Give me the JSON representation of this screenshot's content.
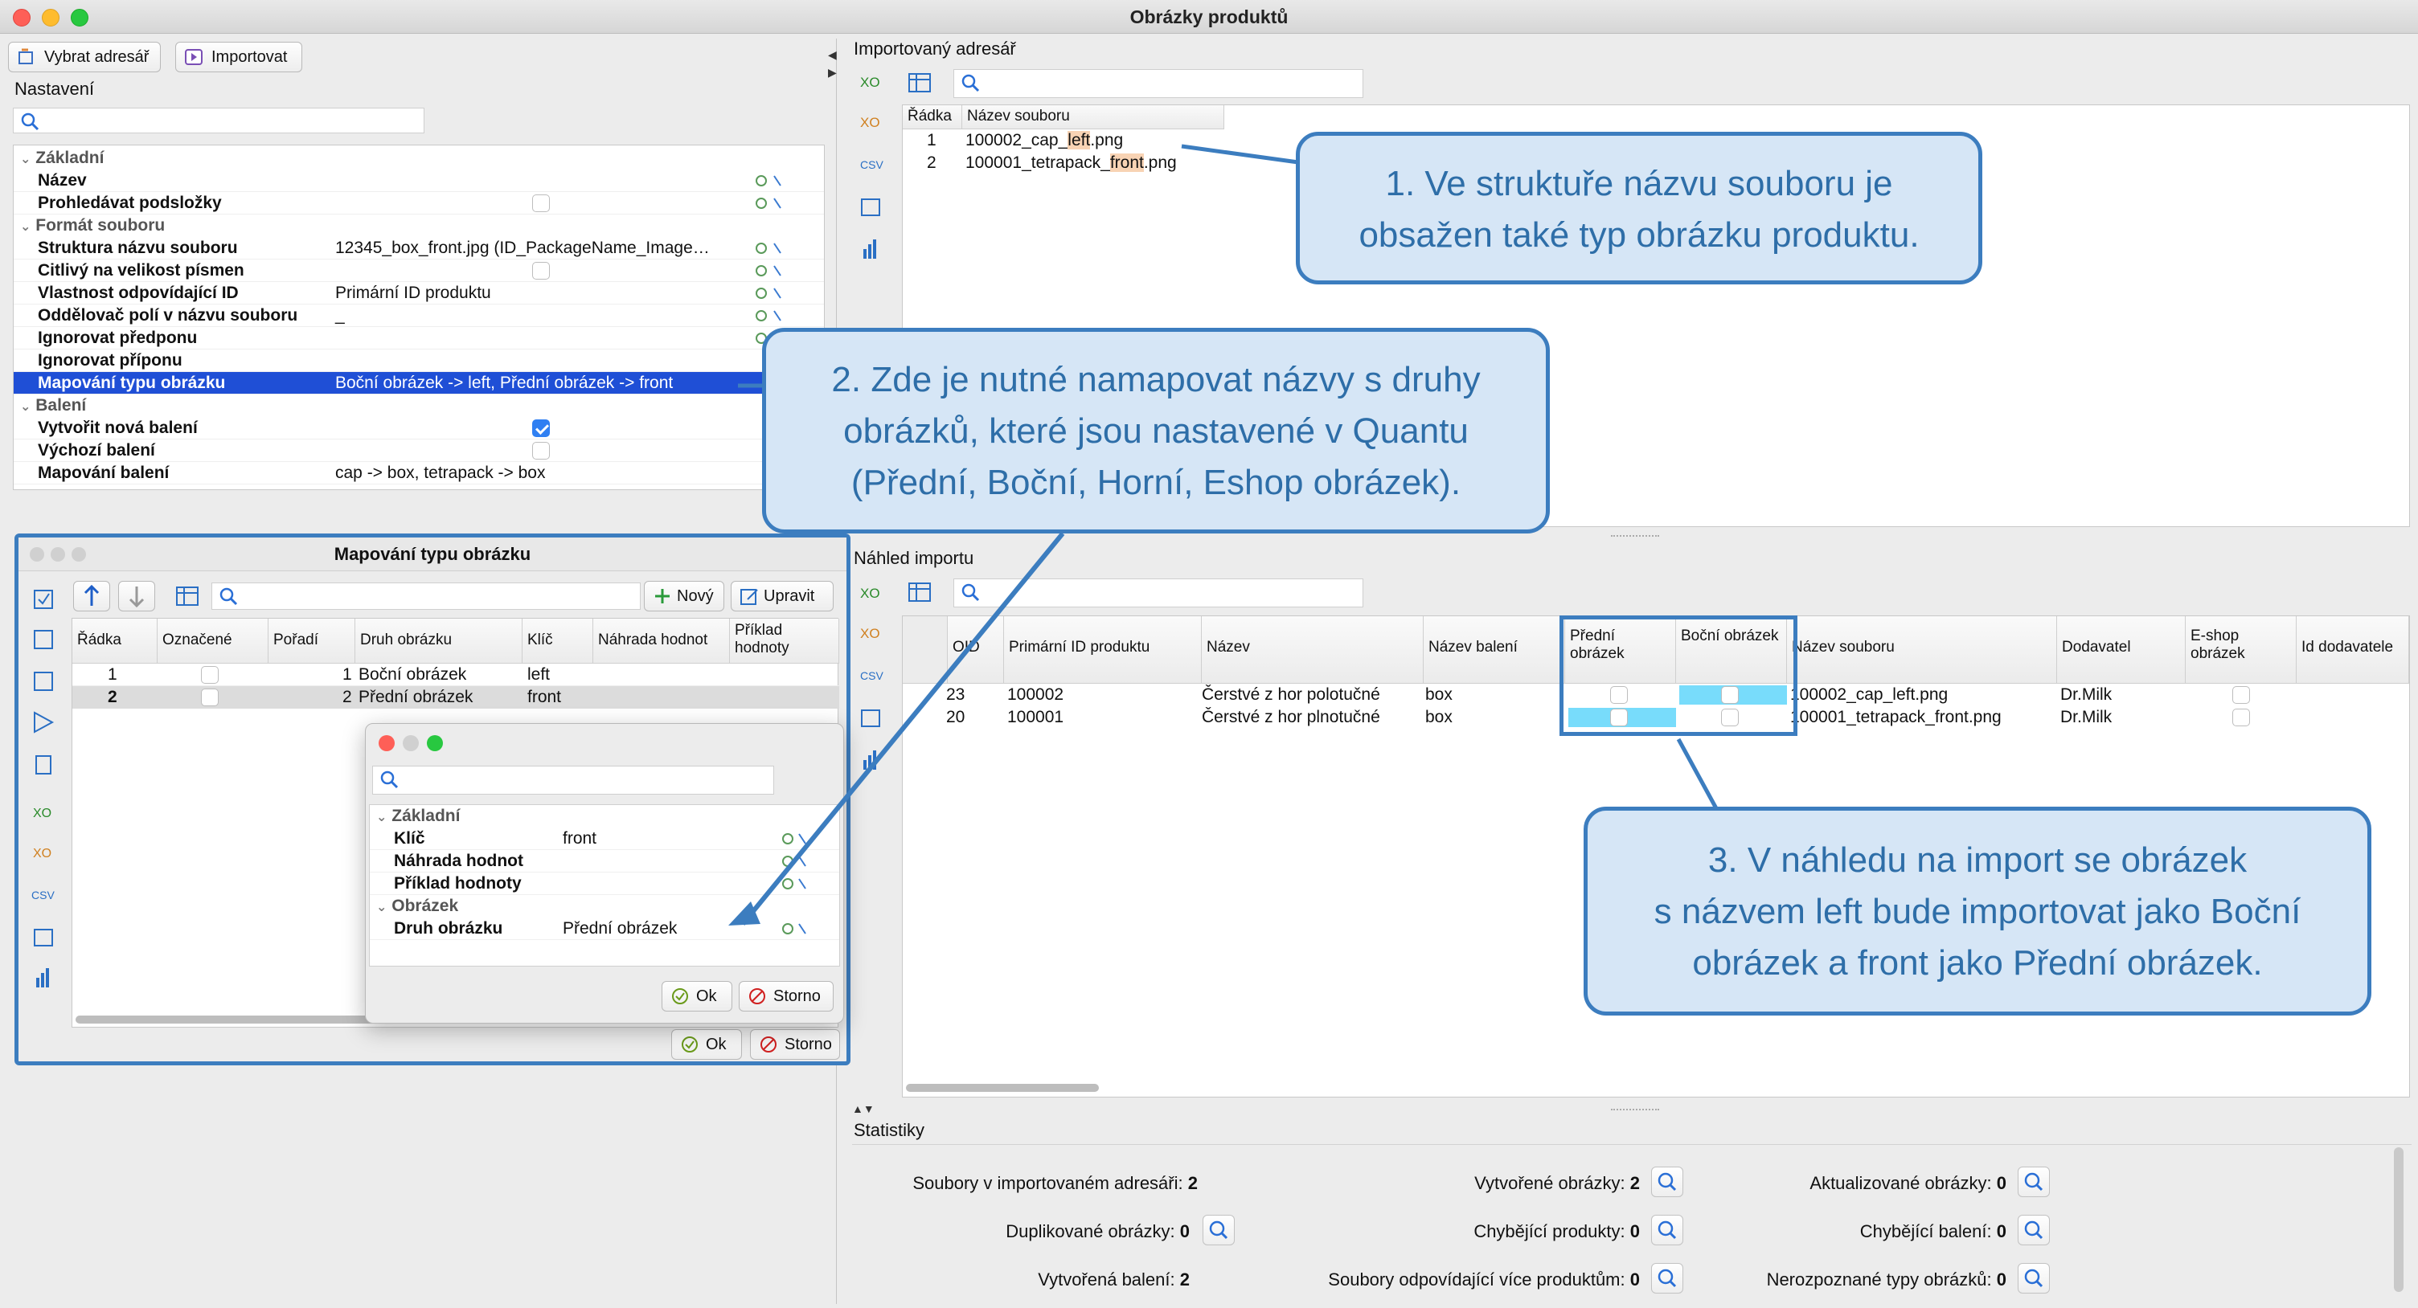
{
  "window": {
    "title": "Obrázky produktů"
  },
  "toolbar": {
    "select_dir": "Vybrat adresář",
    "import": "Importovat"
  },
  "settings": {
    "title": "Nastavení",
    "groups": {
      "basic": "Základní",
      "format": "Formát souboru",
      "packaging": "Balení"
    },
    "rows": [
      {
        "label": "Název",
        "value": ""
      },
      {
        "label": "Prohledávat podsložky",
        "value": ""
      },
      {
        "label": "Struktura názvu souboru",
        "value": "12345_box_front.jpg (ID_PackageName_Image…"
      },
      {
        "label": "Citlivý na velikost písmen",
        "value": ""
      },
      {
        "label": "Vlastnost odpovídající ID",
        "value": "Primární ID produktu"
      },
      {
        "label": "Oddělovač polí v názvu souboru",
        "value": "_"
      },
      {
        "label": "Ignorovat předponu",
        "value": ""
      },
      {
        "label": "Ignorovat příponu",
        "value": ""
      },
      {
        "label": "Mapování typu obrázku",
        "value": "Boční obrázek -> left, Přední obrázek -> front"
      },
      {
        "label": "Vytvořit nová balení",
        "value": ""
      },
      {
        "label": "Výchozí balení",
        "value": ""
      },
      {
        "label": "Mapování balení",
        "value": "cap -> box, tetrapack -> box"
      }
    ]
  },
  "mapping_dialog": {
    "title": "Mapování typu obrázku",
    "new": "Nový",
    "edit": "Upravit",
    "columns": [
      "Řádka",
      "Označené",
      "Pořadí",
      "Druh obrázku",
      "Klíč",
      "Náhrada hodnot",
      "Příklad hodnoty"
    ],
    "rows": [
      {
        "row": "1",
        "order": "1",
        "type": "Boční obrázek",
        "key": "left"
      },
      {
        "row": "2",
        "order": "2",
        "type": "Přední obrázek",
        "key": "front"
      }
    ],
    "ok": "Ok",
    "cancel": "Storno"
  },
  "edit_dialog": {
    "group_basic": "Základní",
    "key_label": "Klíč",
    "key_value": "front",
    "replace_label": "Náhrada hodnot",
    "example_label": "Příklad hodnoty",
    "group_image": "Obrázek",
    "type_label": "Druh obrázku",
    "type_value": "Přední obrázek",
    "ok": "Ok",
    "cancel": "Storno"
  },
  "imported_dir": {
    "title": "Importovaný adresář",
    "columns": [
      "Řádka",
      "Název souboru"
    ],
    "rows": [
      {
        "row": "1",
        "pre": "100002_cap_",
        "hl": "left",
        "post": ".png"
      },
      {
        "row": "2",
        "pre": "100001_tetrapack_",
        "hl": "front",
        "post": ".png"
      }
    ]
  },
  "preview": {
    "title": "Náhled importu",
    "columns": [
      "OID",
      "Primární ID produktu",
      "Název",
      "Název balení",
      "Přední obrázek",
      "Boční obrázek",
      "Název souboru",
      "Dodavatel",
      "E-shop obrázek",
      "Id dodavatele"
    ],
    "rows": [
      {
        "oid": "23",
        "pid": "100002",
        "name": "Čerstvé z hor polotučné",
        "pack": "box",
        "file": "100002_cap_left.png",
        "supplier": "Dr.Milk"
      },
      {
        "oid": "20",
        "pid": "100001",
        "name": "Čerstvé z hor plnotučné",
        "pack": "box",
        "file": "100001_tetrapack_front.png",
        "supplier": "Dr.Milk"
      }
    ]
  },
  "stats": {
    "title": "Statistiky",
    "files_label": "Soubory v importovaném adresáři:",
    "files_value": "2",
    "dup_label": "Duplikované obrázky:",
    "dup_value": "0",
    "pack_label": "Vytvořená balení:",
    "pack_value": "2",
    "created_label": "Vytvořené obrázky:",
    "created_value": "2",
    "missing_label": "Chybějící produkty:",
    "missing_value": "0",
    "multi_label": "Soubory odpovídající více produktům:",
    "multi_value": "0",
    "updated_label": "Aktualizované obrázky:",
    "updated_value": "0",
    "missing_pack_label": "Chybějící balení:",
    "missing_pack_value": "0",
    "unknown_label": "Nerozpoznané typy obrázků:",
    "unknown_value": "0"
  },
  "callouts": {
    "c1_line1": "1. Ve struktuře názvu souboru je",
    "c1_line2": "obsažen také typ obrázku produktu.",
    "c2_line1": "2. Zde je nutné namapovat názvy s druhy",
    "c2_line2": "obrázků, které jsou nastavené v Quantu",
    "c2_line3": "(Přední, Boční, Horní, Eshop obrázek).",
    "c3_line1": "3. V náhledu na import se obrázek",
    "c3_line2": "s názvem left bude importovat jako Boční",
    "c3_line3": "obrázek a front jako Přední obrázek."
  },
  "colors": {
    "accent": "#3c7dbf",
    "callout_bg": "#d6e6f6",
    "selection": "#1f4fd6",
    "highlight_cell": "#78dcfb",
    "file_highlight": "#f8d3b4"
  }
}
